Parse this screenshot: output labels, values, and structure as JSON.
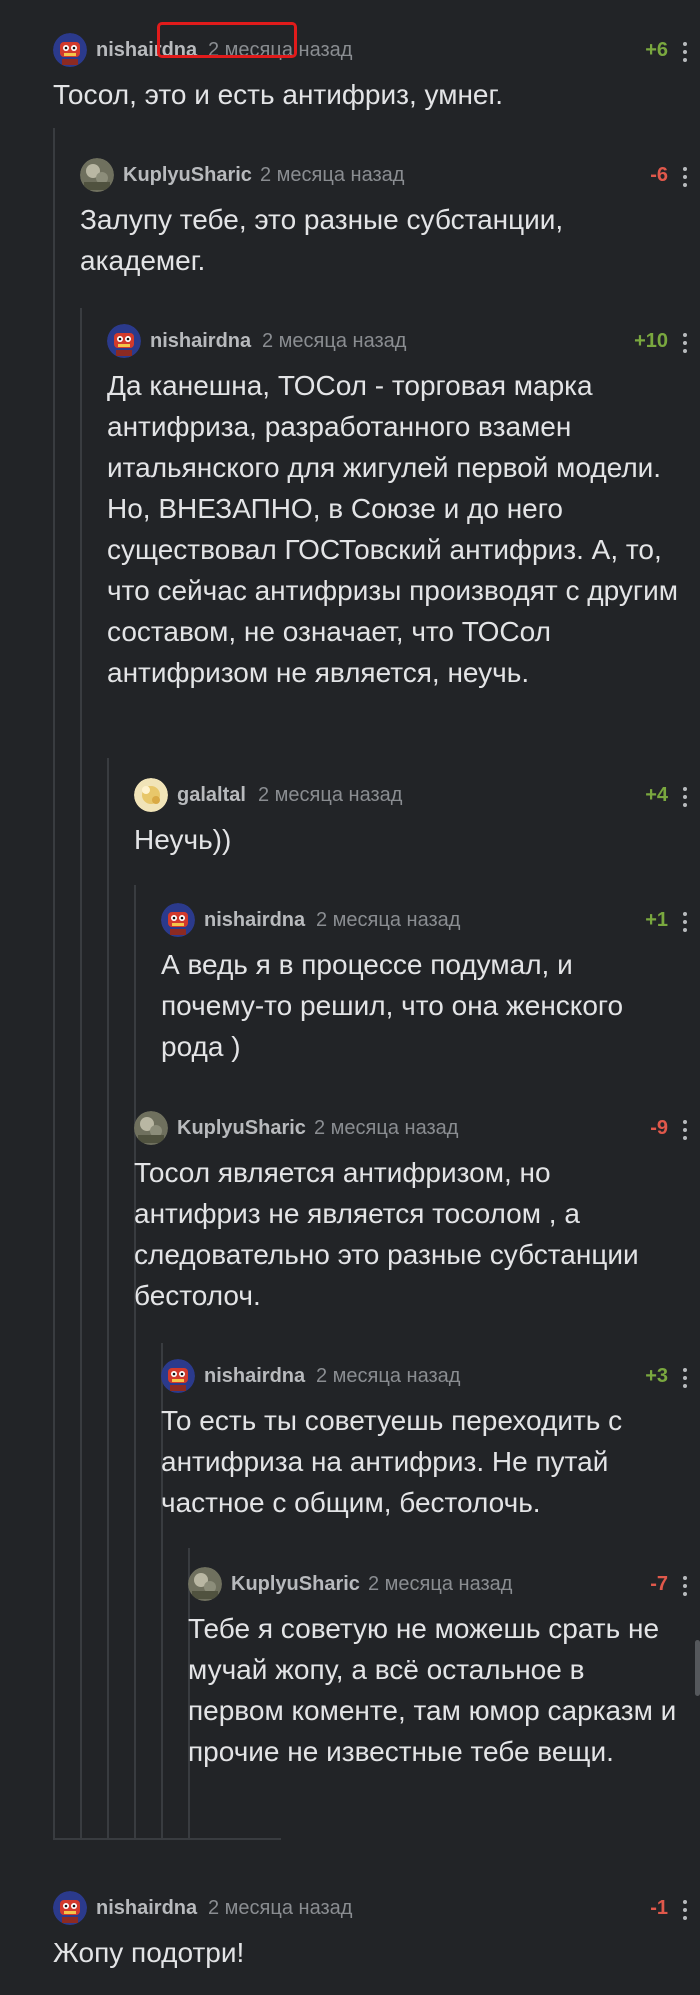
{
  "comments": [
    {
      "author": "nishairdna",
      "time": "2 месяца назад",
      "rating": "+6",
      "sign": "pos",
      "avatar": "robot",
      "text": "Тосол, это и есть антифриз, умнег."
    },
    {
      "author": "KuplyuSharic",
      "time": "2 месяца назад",
      "rating": "-6",
      "sign": "neg",
      "avatar": "photo",
      "text": "Залупу тебе, это разные субстанции, академег."
    },
    {
      "author": "nishairdna",
      "time": "2 месяца назад",
      "rating": "+10",
      "sign": "pos",
      "avatar": "robot",
      "text": "Да канешна, ТОСол - торговая марка антифриза, разработанного взамен итальянского для жигулей первой модели. Но, ВНЕЗАПНО, в Союзе и до него существовал ГОСТовский антифриз. А, то, что сейчас антифризы производят с другим составом, не означает, что ТОСол антифризом не является, неучь."
    },
    {
      "author": "galaltal",
      "time": "2 месяца назад",
      "rating": "+4",
      "sign": "pos",
      "avatar": "flower",
      "text": "Неучь))"
    },
    {
      "author": "nishairdna",
      "time": "2 месяца назад",
      "rating": "+1",
      "sign": "pos",
      "avatar": "robot",
      "text": "А ведь я в процессе подумал, и почему-то решил, что она женского рода )"
    },
    {
      "author": "KuplyuSharic",
      "time": "2 месяца назад",
      "rating": "-9",
      "sign": "neg",
      "avatar": "photo",
      "text": "Тосол является антифризом, но антифриз не является тосолом , а следовательно это разные субстанции бестолоч."
    },
    {
      "author": "nishairdna",
      "time": "2 месяца назад",
      "rating": "+3",
      "sign": "pos",
      "avatar": "robot",
      "text": "То есть ты советуешь переходить с антифриза на антифриз. Не путай частное с общим, бестолочь."
    },
    {
      "author": "KuplyuSharic",
      "time": "2 месяца назад",
      "rating": "-7",
      "sign": "neg",
      "avatar": "photo",
      "text": "Тебе я советую не можешь срать не мучай жопу, а всё остальное в первом коменте, там юмор сарказм и прочие не известные тебе вещи."
    },
    {
      "author": "nishairdna",
      "time": "2 месяца назад",
      "rating": "-1",
      "sign": "neg",
      "avatar": "robot",
      "text": "Жопу подотри!"
    }
  ],
  "colors": {
    "positive": "#7aa83f",
    "negative": "#e0584b",
    "highlight": "#e11b1b"
  }
}
